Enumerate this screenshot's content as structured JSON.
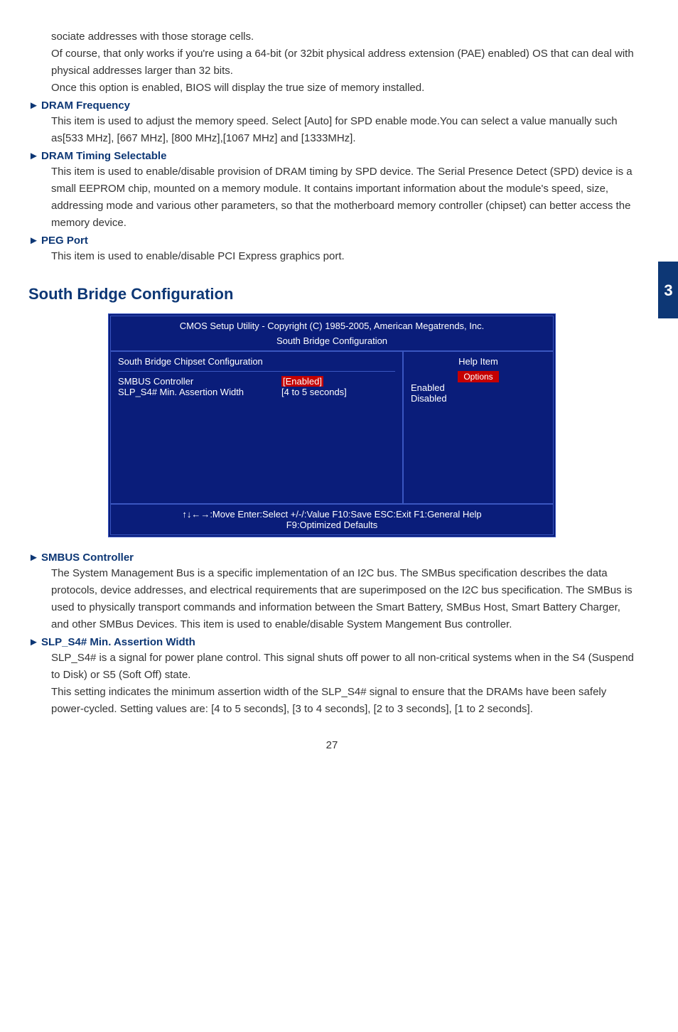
{
  "sideTab": "3",
  "intro": {
    "p1": "sociate addresses with those storage cells.",
    "p2": "Of course, that only works if you're using a 64-bit (or 32bit physical address extension (PAE) enabled) OS that can deal with physical addresses larger than 32 bits.",
    "p3": "Once this option is enabled, BIOS will display the true size of memory installed."
  },
  "items": {
    "dramFreq": {
      "title": "DRAM Frequency",
      "body": "This item is used to adjust the memory speed. Select [Auto] for SPD enable mode.You can select a value manually such as[533 MHz], [667 MHz], [800 MHz],[1067 MHz] and [1333MHz]."
    },
    "dramTiming": {
      "title": "DRAM Timing Selectable",
      "body": "This item is used to enable/disable provision of DRAM timing by SPD device. The Serial Presence Detect (SPD) device is a small EEPROM chip, mounted on a memory module. It contains important information about the module's speed, size, addressing mode and various other parameters, so that the motherboard memory controller (chipset) can better access the memory device."
    },
    "pegPort": {
      "title": "PEG Port",
      "body": "This item is used to enable/disable PCI Express graphics port."
    },
    "smbus": {
      "title": "SMBUS Controller",
      "body": "The System Management Bus is a specific implementation of an I2C bus. The SMBus specification describes the data protocols, device addresses, and electrical requirements that are superimposed on the I2C bus specification. The SMBus is used to physically transport commands and information between the Smart Battery, SMBus Host, Smart Battery Charger, and other SMBus Devices. This item is used to enable/disable System Mangement Bus controller."
    },
    "slp": {
      "title": "SLP_S4# Min. Assertion Width",
      "body1": "SLP_S4# is a signal for power plane control. This signal shuts off power to all non-critical systems when in the S4 (Suspend to Disk) or S5 (Soft Off) state.",
      "body2": "This setting indicates the minimum assertion width of the SLP_S4# signal to ensure that the DRAMs have been safely power-cycled. Setting values are: [4 to 5 seconds],  [3 to 4 seconds],  [2 to 3 seconds],  [1 to 2 seconds]."
    }
  },
  "section": "South Bridge Configuration",
  "bios": {
    "title": "CMOS Setup Utility - Copyright (C) 1985-2005, American Megatrends, Inc.",
    "sub": "South Bridge Configuration",
    "leftHeader": "South Bridge Chipset Configuration",
    "row1k": "SMBUS Controller",
    "row1v": "[Enabled]",
    "row2k": "SLP_S4# Min. Assertion Width",
    "row2v": "[4 to 5 seconds]",
    "rightHeader": "Help Item",
    "options": "Options",
    "opt1": "Enabled",
    "opt2": "Disabled",
    "footer1": "↑↓←→:Move   Enter:Select   +/-/:Value   F10:Save   ESC:Exit   F1:General Help",
    "footer2": "F9:Optimized Defaults"
  },
  "pageNum": "27",
  "arrow": "►"
}
